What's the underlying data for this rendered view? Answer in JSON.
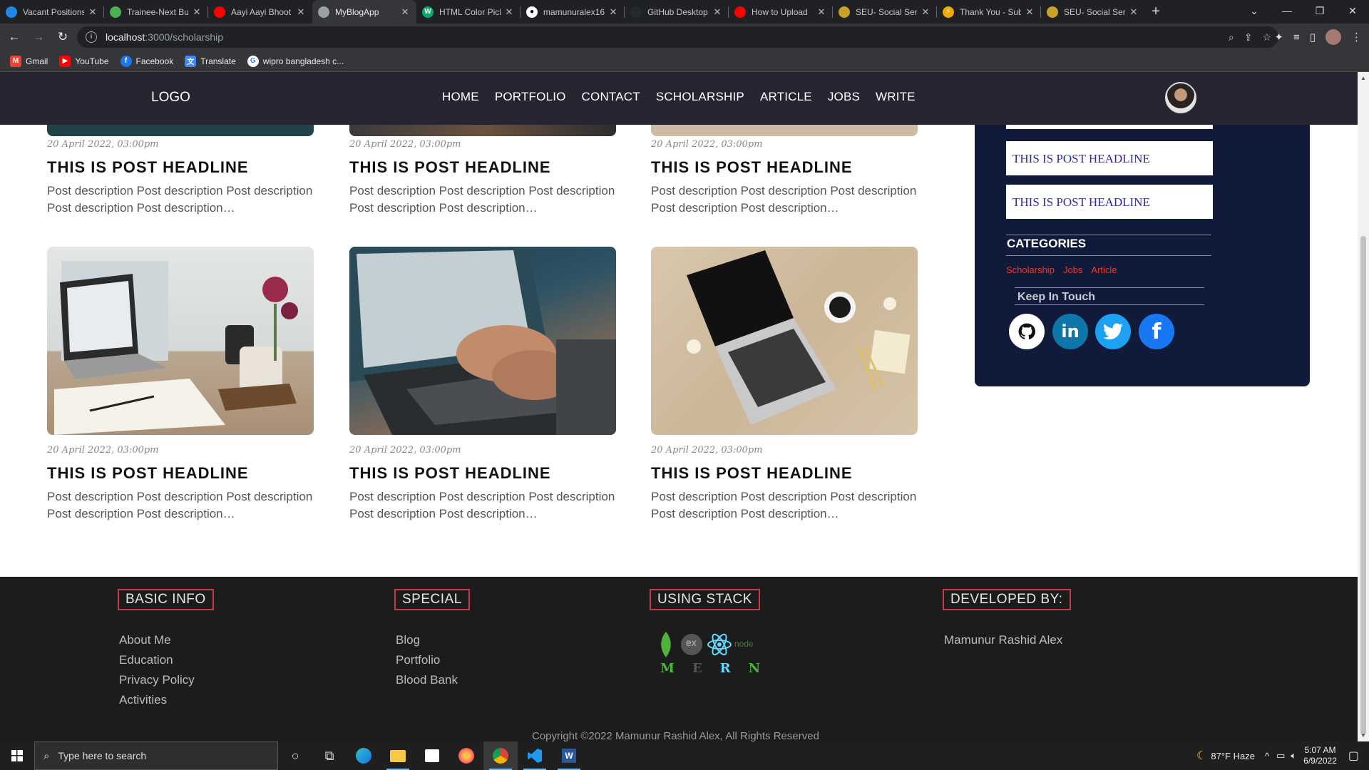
{
  "browser": {
    "tabs": [
      {
        "title": "Vacant Positions",
        "favicon_color": "#1e88e5"
      },
      {
        "title": "Trainee-Next Bu",
        "favicon_color": "#4caf50"
      },
      {
        "title": "Aayi Aayi Bhoot",
        "favicon_color": "#ff0000"
      },
      {
        "title": "MyBlogApp",
        "favicon_color": "#9aa0a6"
      },
      {
        "title": "HTML Color Pick",
        "favicon_color": "#04aa6d"
      },
      {
        "title": "mamunuralex16",
        "favicon_color": "#ffffff"
      },
      {
        "title": "GitHub Desktop",
        "favicon_color": "#24292e"
      },
      {
        "title": "How to Upload",
        "favicon_color": "#ff0000"
      },
      {
        "title": "SEU- Social Ser",
        "favicon_color": "#c9a227"
      },
      {
        "title": "Thank You - Sub",
        "favicon_color": "#f2a900"
      },
      {
        "title": "SEU- Social Ser",
        "favicon_color": "#c9a227"
      }
    ],
    "active_tab_index": 3,
    "url_host": "localhost",
    "url_path": ":3000/scholarship",
    "bookmarks": [
      {
        "label": "Gmail",
        "color": "#ea4335"
      },
      {
        "label": "YouTube",
        "color": "#ff0000"
      },
      {
        "label": "Facebook",
        "color": "#1877f2"
      },
      {
        "label": "Translate",
        "color": "#4285f4"
      },
      {
        "label": "wipro bangladesh c...",
        "color": "#4285f4"
      }
    ]
  },
  "site": {
    "logo": "LOGO",
    "nav": [
      "HOME",
      "PORTFOLIO",
      "CONTACT",
      "SCHOLARSHIP",
      "ARTICLE",
      "JOBS",
      "WRITE"
    ]
  },
  "posts": [
    {
      "date": "20 April 2022, 03:00pm",
      "headline": "THIS IS POST HEADLINE",
      "description": "Post description Post description Post description Post description Post description…"
    },
    {
      "date": "20 April 2022, 03:00pm",
      "headline": "THIS IS POST HEADLINE",
      "description": "Post description Post description Post description Post description Post description…"
    },
    {
      "date": "20 April 2022, 03:00pm",
      "headline": "THIS IS POST HEADLINE",
      "description": "Post description Post description Post description Post description Post description…"
    },
    {
      "date": "20 April 2022, 03:00pm",
      "headline": "THIS IS POST HEADLINE",
      "description": "Post description Post description Post description Post description Post description…",
      "image": "laptop-notebook-desk"
    },
    {
      "date": "20 April 2022, 03:00pm",
      "headline": "THIS IS POST HEADLINE",
      "description": "Post description Post description Post description Post description Post description…",
      "image": "hands-typing-laptop"
    },
    {
      "date": "20 April 2022, 03:00pm",
      "headline": "THIS IS POST HEADLINE",
      "description": "Post description Post description Post description Post description Post description…",
      "image": "laptop-wooden-table"
    }
  ],
  "sidebar": {
    "recent": [
      "THIS IS POST HEADLINE",
      "THIS IS POST HEADLINE"
    ],
    "categories_title": "CATEGORIES",
    "categories": [
      "Scholarship",
      "Jobs",
      "Article"
    ],
    "keep_in_touch": "Keep In Touch",
    "social": [
      {
        "icon": "github-icon",
        "glyph": "◉",
        "bg": "#ffffff",
        "fg": "#111111"
      },
      {
        "icon": "linkedin-icon",
        "glyph": "in",
        "bg": "#0e76a8",
        "fg": "#ffffff"
      },
      {
        "icon": "twitter-icon",
        "glyph": "🐦",
        "bg": "#1da1f2",
        "fg": "#ffffff"
      },
      {
        "icon": "facebook-icon",
        "glyph": "f",
        "bg": "#1877f2",
        "fg": "#ffffff"
      }
    ]
  },
  "footer": {
    "basic_info": {
      "title": "BASIC INFO",
      "items": [
        "About Me",
        "Education",
        "Privacy Policy",
        "Activities"
      ]
    },
    "special": {
      "title": "SPECIAL",
      "items": [
        "Blog",
        "Portfolio",
        "Blood Bank"
      ]
    },
    "stack": {
      "title": "USING STACK",
      "letters": [
        "M",
        "E",
        "R",
        "N"
      ],
      "logo_labels": [
        "ex",
        "node"
      ]
    },
    "developer": {
      "title": "DEVELOPED BY:",
      "name": "Mamunur Rashid Alex"
    },
    "copyright": "Copyright ©2022 Mamunur Rashid Alex, All Rights Reserved"
  },
  "taskbar": {
    "search_placeholder": "Type here to search",
    "weather": "87°F  Haze",
    "time": "5:07 AM",
    "date": "6/9/2022"
  }
}
